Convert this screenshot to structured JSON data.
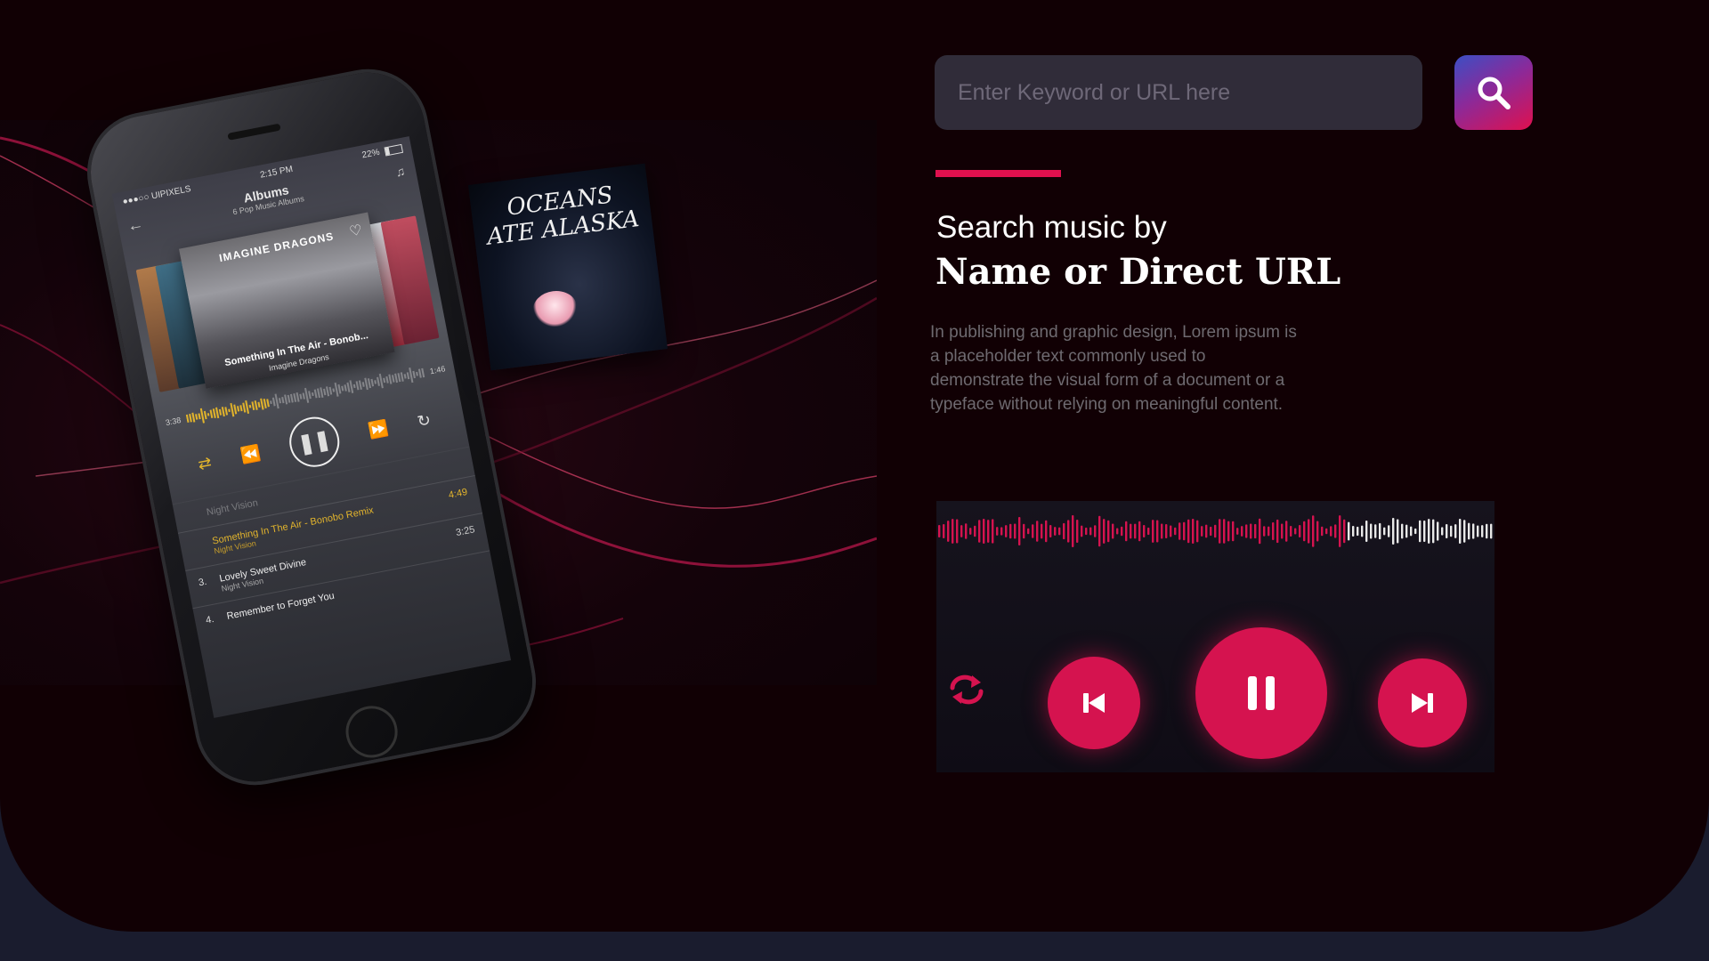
{
  "search": {
    "placeholder": "Enter Keyword or URL here",
    "button_icon": "search-icon"
  },
  "hero": {
    "subtitle": "Search music by",
    "headline": "Name or Direct URL",
    "description": "In publishing and graphic design, Lorem ipsum is a placeholder text commonly used to demonstrate the visual form of a document or a typeface without relying on meaningful content."
  },
  "phone": {
    "status": {
      "carrier": "●●●○○ UIPIXELS",
      "time": "2:15 PM",
      "battery": "22%"
    },
    "header": {
      "title": "Albums",
      "subtitle": "6 Pop Music Albums"
    },
    "album": {
      "band": "IMAGINE DRAGONS",
      "song": "Something In The Air - Bonob...",
      "artist": "Imagine Dragons"
    },
    "progress": {
      "elapsed": "3:38",
      "remaining": "1:46",
      "fraction": 0.35
    },
    "tracks": [
      {
        "num": "",
        "title": "Night Vision",
        "sub": "",
        "duration": "",
        "state": "dim"
      },
      {
        "num": "",
        "title": "Something In The Air - Bonobo Remix",
        "sub": "Night Vision",
        "duration": "4:49",
        "state": "active"
      },
      {
        "num": "3.",
        "title": "Lovely Sweet Divine",
        "sub": "Night Vision",
        "duration": "3:25",
        "state": "normal"
      },
      {
        "num": "4.",
        "title": "Remember to Forget You",
        "sub": "",
        "duration": "",
        "state": "normal"
      }
    ]
  },
  "floating_album": {
    "text": "OCEANS ATE ALASKA"
  },
  "colors": {
    "accent": "#e0104e",
    "panel_bg": "#110004",
    "page_bg": "#1a1c2e",
    "input_bg": "#302c39",
    "waveform_played": "#d5134f",
    "waveform_rest": "#e8e8e8",
    "phone_wave_played": "#e2b42c"
  },
  "player_card": {
    "progress_fraction": 0.73,
    "icons": [
      "repeat-icon",
      "previous-icon",
      "pause-icon",
      "next-icon"
    ]
  }
}
